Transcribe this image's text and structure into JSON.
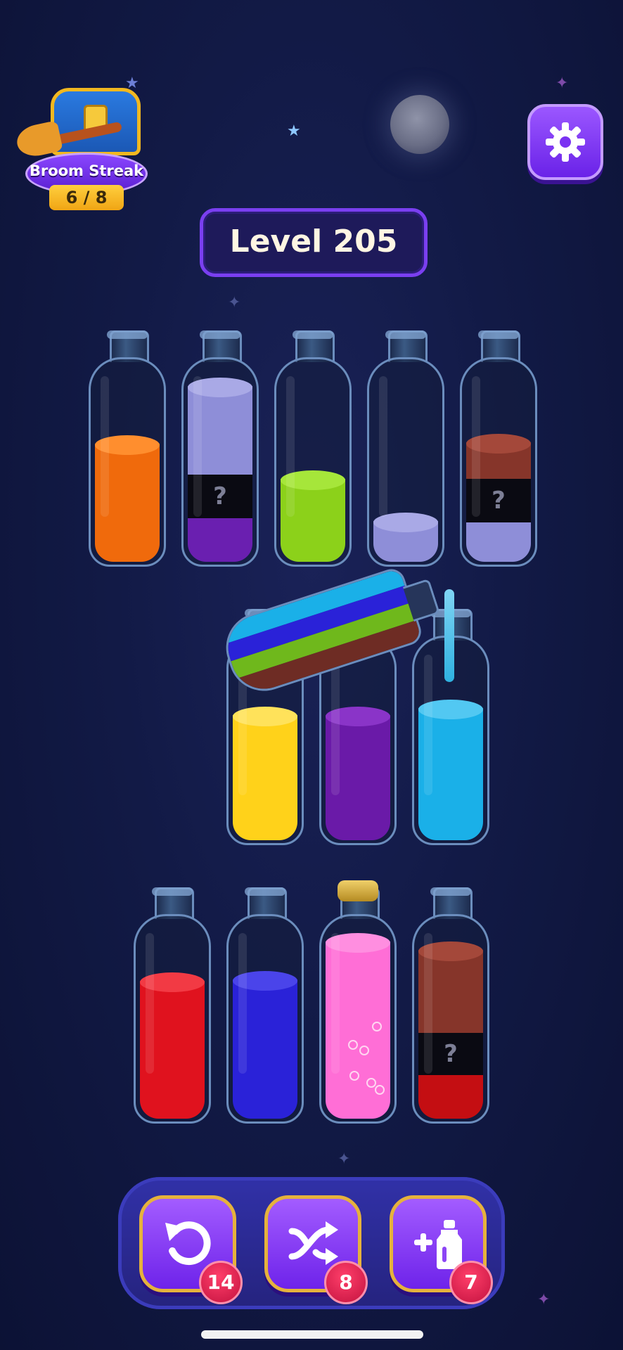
{
  "header": {
    "streak_title": "Broom Streak",
    "streak_progress": "6 / 8",
    "level_title": "Level 205"
  },
  "tools": [
    {
      "name": "undo",
      "count": "14"
    },
    {
      "name": "shuffle",
      "count": "8"
    },
    {
      "name": "add-bottle",
      "count": "7"
    }
  ],
  "colors": {
    "orange": "#f06a0c",
    "lavender": "#8e8ed8",
    "purple": "#6a1fb0",
    "lime": "#8cd11a",
    "brown": "#86352a",
    "yellow": "#ffd21a",
    "violet": "#6a1aa8",
    "cyan": "#1ab0e8",
    "red": "#e0121e",
    "blue": "#2a22d8",
    "pink": "#ff6ed6",
    "mystery_mark": "?"
  },
  "bottles_row1": [
    {
      "layers": [
        "orange"
      ]
    },
    {
      "layers": [
        "lavender",
        "?",
        "purple"
      ]
    },
    {
      "layers": [
        "lime"
      ]
    },
    {
      "layers": [
        "lavender"
      ]
    },
    {
      "layers": [
        "brown",
        "?",
        "lavender"
      ]
    }
  ],
  "bottles_row2": [
    {
      "layers": [
        "yellow"
      ]
    },
    {
      "layers": [
        "violet"
      ]
    },
    {
      "layers": [
        "cyan"
      ]
    }
  ],
  "bottles_row3": [
    {
      "layers": [
        "red"
      ]
    },
    {
      "layers": [
        "blue"
      ]
    },
    {
      "layers": [
        "pink"
      ],
      "capped": true
    },
    {
      "layers": [
        "brown",
        "?",
        "red"
      ]
    }
  ]
}
